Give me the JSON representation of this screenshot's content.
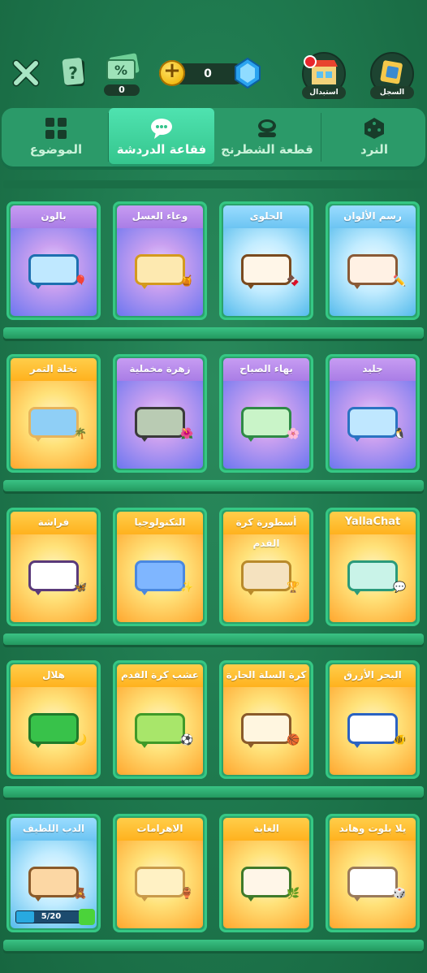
{
  "topbar": {
    "coupon_count": "0",
    "currency_value": "0",
    "exchange_label": "استبدال",
    "history_label": "السجل"
  },
  "tabs": [
    {
      "label": "الموضوع",
      "icon": "grid-icon",
      "active": false
    },
    {
      "label": "فقاعة الدردشة",
      "icon": "chat-bubble-icon",
      "active": true
    },
    {
      "label": "قطعة الشطرنج",
      "icon": "chess-piece-icon",
      "active": false
    },
    {
      "label": "النرد",
      "icon": "dice-icon",
      "active": false
    }
  ],
  "rows": [
    [
      {
        "title": "بالون",
        "theme": "purple",
        "bubble": "#bfe8ff",
        "border": "#1e6fb0",
        "deco": "🎈"
      },
      {
        "title": "وعاء العسل",
        "theme": "purple",
        "bubble": "#fde9b0",
        "border": "#d49a1d",
        "deco": "🍯"
      },
      {
        "title": "الحلوى",
        "theme": "blue",
        "bubble": "#fff6e8",
        "border": "#7a4a1e",
        "deco": "🍫"
      },
      {
        "title": "رسم الألوان",
        "theme": "blue",
        "bubble": "#fff1e4",
        "border": "#8a5a36",
        "deco": "✏️"
      }
    ],
    [
      {
        "title": "نخلة التمر",
        "theme": "orange",
        "bubble": "#8fcff6",
        "border": "#e6b45c",
        "deco": "🌴"
      },
      {
        "title": "زهرة مخملية",
        "theme": "purple",
        "bubble": "#b9cbb3",
        "border": "#3a3a3a",
        "deco": "🌺"
      },
      {
        "title": "بهاء الصباح",
        "theme": "purple",
        "bubble": "#c9f4c8",
        "border": "#2f8a46",
        "deco": "🌸"
      },
      {
        "title": "جليد",
        "theme": "purple",
        "bubble": "#bfe7ff",
        "border": "#2a73c2",
        "deco": "🐧"
      }
    ],
    [
      {
        "title": "فراشة",
        "theme": "orange",
        "bubble": "#ffffff",
        "border": "#5a3a7a",
        "deco": "🦋"
      },
      {
        "title": "التكنولوجيا",
        "theme": "orange",
        "bubble": "#7fb6ff",
        "border": "#4a88e0",
        "deco": "✨"
      },
      {
        "title": "أسطورة كرة القدم",
        "theme": "orange",
        "bubble": "#f5e2bf",
        "border": "#b98a2a",
        "deco": "🏆"
      },
      {
        "title": "YallaChat",
        "theme": "orange",
        "bubble": "#c9f3e8",
        "border": "#2a9a7a",
        "deco": "💬"
      }
    ],
    [
      {
        "title": "هلال",
        "theme": "orange",
        "bubble": "#38c24a",
        "border": "#1f7a2a",
        "deco": "🌙"
      },
      {
        "title": "عشب كرة القدم",
        "theme": "orange",
        "bubble": "#a8e66a",
        "border": "#3f9a28",
        "deco": "⚽"
      },
      {
        "title": "كرة السلة الحارة",
        "theme": "orange",
        "bubble": "#fff6e0",
        "border": "#8a5a2a",
        "deco": "🏀"
      },
      {
        "title": "البحر الأزرق",
        "theme": "orange",
        "bubble": "#ffffff",
        "border": "#2a62c2",
        "deco": "🐠"
      }
    ],
    [
      {
        "title": "الدب اللطيف",
        "theme": "blue",
        "bubble": "#fcd7a4",
        "border": "#8a5a2a",
        "deco": "🧸",
        "progress": "5/20",
        "progress_value": 0.25
      },
      {
        "title": "الاهرامات",
        "theme": "orange",
        "bubble": "#fff1c4",
        "border": "#c99a4a",
        "deco": "🏺"
      },
      {
        "title": "الغابة",
        "theme": "orange",
        "bubble": "#fff6e8",
        "border": "#3f7a2a",
        "deco": "🌿"
      },
      {
        "title": "يلا بلوت وهاند",
        "theme": "orange",
        "bubble": "#ffffff",
        "border": "#9a7a5a",
        "deco": "🎲"
      }
    ]
  ],
  "colors": {
    "purple_top": "#c9a0f0",
    "purple_bottom": "#5a6ef0",
    "blue_top": "#c2ecff",
    "blue_bottom": "#3cb0e8",
    "orange_top": "#ffe27a",
    "orange_bottom": "#ff9a1e"
  }
}
